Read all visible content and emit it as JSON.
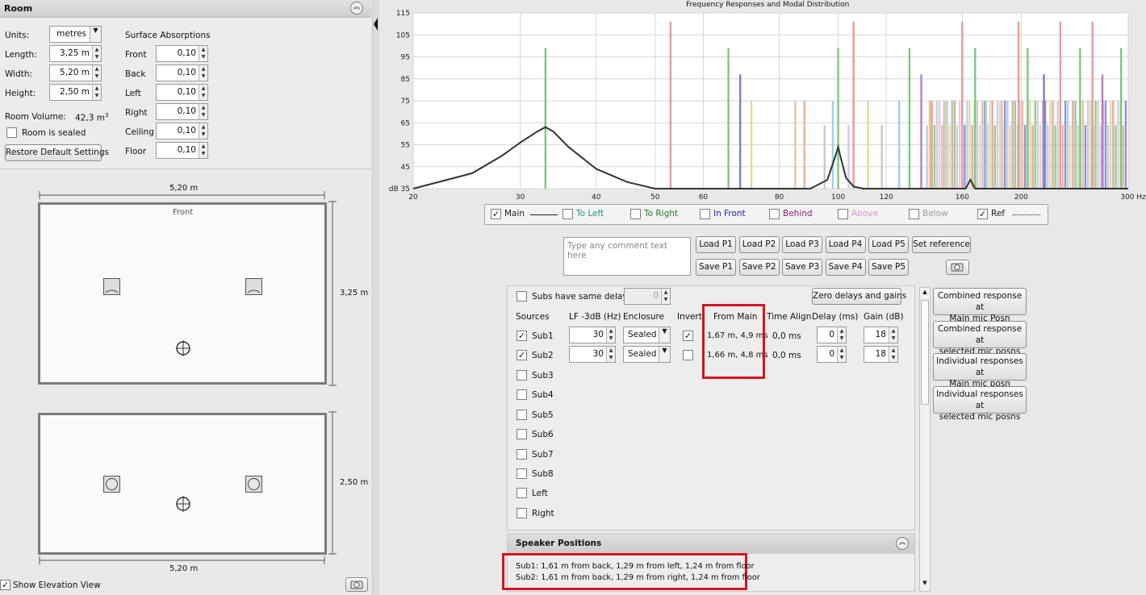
{
  "room": {
    "title": "Room",
    "units_label": "Units:",
    "units_value": "metres",
    "length_label": "Length:",
    "length_value": "3,25 m",
    "width_label": "Width:",
    "width_value": "5,20 m",
    "height_label": "Height:",
    "height_value": "2,50 m",
    "volume_label": "Room Volume:",
    "volume_value": "42,3 m",
    "volume_sup": "3",
    "sealed_label": "Room is sealed",
    "restore_label": "Restore Default Settings",
    "absorptions_title": "Surface Absorptions",
    "surfaces": [
      {
        "label": "Front",
        "value": "0,10"
      },
      {
        "label": "Back",
        "value": "0,10"
      },
      {
        "label": "Left",
        "value": "0,10"
      },
      {
        "label": "Right",
        "value": "0,10"
      },
      {
        "label": "Ceiling",
        "value": "0,10"
      },
      {
        "label": "Floor",
        "value": "0,10"
      }
    ]
  },
  "plan": {
    "top_width": "5,20 m",
    "front_label": "Front",
    "depth": "3,25 m",
    "height": "2,50 m",
    "bottom_width": "5,20 m",
    "show_elevation": "Show Elevation View"
  },
  "chart_data": {
    "type": "line",
    "title": "Frequency Responses and Modal Distribution",
    "xlabel": "Hz",
    "ylabel": "dB",
    "x_scale": "log",
    "xlim": [
      20,
      300
    ],
    "ylim": [
      35,
      115
    ],
    "x_ticks": [
      "20",
      "30",
      "40",
      "50",
      "60",
      "80",
      "100",
      "120",
      "160",
      "200",
      "300 Hz"
    ],
    "y_ticks": [
      "115",
      "105",
      "95",
      "85",
      "75",
      "65",
      "55",
      "45",
      "dB 35"
    ],
    "grid": true,
    "series": [
      {
        "name": "Main",
        "x": [
          20,
          25,
          28,
          30,
          32,
          33,
          34,
          36,
          40,
          45,
          50,
          90,
          96,
          99,
          100,
          101,
          103,
          106,
          110,
          150,
          162,
          165,
          168,
          300
        ],
        "y": [
          35,
          42,
          50,
          56,
          61,
          63,
          61,
          54,
          44,
          38,
          35,
          35,
          39,
          50,
          54,
          49,
          40,
          36,
          35,
          35,
          35,
          39,
          35,
          35
        ]
      }
    ],
    "modal_lines": [
      {
        "f": 33,
        "db": 99,
        "color": "#7fc77f"
      },
      {
        "f": 53,
        "db": 111,
        "color": "#e89a9a"
      },
      {
        "f": 66,
        "db": 99,
        "color": "#7fc77f"
      },
      {
        "f": 69,
        "db": 87,
        "color": "#7f7fc7"
      },
      {
        "f": 72,
        "db": 75,
        "color": "#e5d79a"
      },
      {
        "f": 85,
        "db": 75,
        "color": "#e5c79a"
      },
      {
        "f": 88,
        "db": 75,
        "color": "#e8b38f"
      },
      {
        "f": 95,
        "db": 64,
        "color": "#c9c9c9"
      },
      {
        "f": 98,
        "db": 75,
        "color": "#9fd0e8"
      },
      {
        "f": 100,
        "db": 99,
        "color": "#7fc77f"
      },
      {
        "f": 104,
        "db": 64,
        "color": "#d8c7e8"
      },
      {
        "f": 106,
        "db": 111,
        "color": "#e89a9a"
      },
      {
        "f": 112,
        "db": 75,
        "color": "#e5d79a"
      },
      {
        "f": 118,
        "db": 64,
        "color": "#c9c9c9"
      },
      {
        "f": 126,
        "db": 75,
        "color": "#9fd0e8"
      },
      {
        "f": 131,
        "db": 99,
        "color": "#7fc77f"
      },
      {
        "f": 137,
        "db": 87,
        "color": "#b27fc7"
      },
      {
        "f": 142,
        "db": 75,
        "color": "#e8b38f"
      },
      {
        "f": 150,
        "db": 75,
        "color": "#e5d79a"
      },
      {
        "f": 160,
        "db": 111,
        "color": "#e89a9a"
      },
      {
        "f": 168,
        "db": 99,
        "color": "#7fc77f"
      },
      {
        "f": 175,
        "db": 75,
        "color": "#9fd0e8"
      },
      {
        "f": 186,
        "db": 75,
        "color": "#e5c79a"
      },
      {
        "f": 198,
        "db": 111,
        "color": "#e89a9a"
      },
      {
        "f": 205,
        "db": 99,
        "color": "#7fc77f"
      },
      {
        "f": 218,
        "db": 87,
        "color": "#7f7fc7"
      },
      {
        "f": 232,
        "db": 111,
        "color": "#e89a9a"
      },
      {
        "f": 250,
        "db": 99,
        "color": "#7fc77f"
      },
      {
        "f": 262,
        "db": 111,
        "color": "#e89a9a"
      },
      {
        "f": 272,
        "db": 87,
        "color": "#b27fc7"
      },
      {
        "f": 292,
        "db": 99,
        "color": "#7fc77f"
      }
    ],
    "dense_region": {
      "from": 140,
      "to": 300,
      "db": 75
    }
  },
  "legend": [
    {
      "label": "Main",
      "checked": true,
      "color": "#222222",
      "line": "solid"
    },
    {
      "label": "To Left",
      "checked": false,
      "color": "#2a8f8f"
    },
    {
      "label": "To Right",
      "checked": false,
      "color": "#2a7a2a"
    },
    {
      "label": "In Front",
      "checked": false,
      "color": "#23239a"
    },
    {
      "label": "Behind",
      "checked": false,
      "color": "#7a1f7a"
    },
    {
      "label": "Above",
      "checked": false,
      "color": "#d49ad4"
    },
    {
      "label": "Below",
      "checked": false,
      "color": "#9a9a9a"
    },
    {
      "label": "Ref",
      "checked": true,
      "color": "#222222",
      "line": "dotted"
    }
  ],
  "comment_placeholder": "Type any comment text here",
  "load_buttons": [
    "Load P1",
    "Load P2",
    "Load P3",
    "Load P4",
    "Load P5"
  ],
  "save_buttons": [
    "Save P1",
    "Save P2",
    "Save P3",
    "Save P4",
    "Save P5"
  ],
  "set_reference": "Set reference",
  "subs": {
    "same_delay_label": "Subs have same delay",
    "same_delay_value": "0",
    "zero_button": "Zero delays and gains",
    "headers": {
      "sources": "Sources",
      "lf": "LF -3dB (Hz)",
      "enclosure": "Enclosure",
      "invert": "Invert",
      "from_main": "From Main",
      "time_align": "Time Align",
      "delay": "Delay (ms)",
      "gain": "Gain (dB)"
    },
    "active": [
      {
        "name": "Sub1",
        "checked": true,
        "lf": "30",
        "enclosure": "Sealed",
        "invert": true,
        "from_main": "1,67 m, 4,9 ms",
        "time_align": "0,0 ms",
        "delay": "0",
        "gain": "18"
      },
      {
        "name": "Sub2",
        "checked": true,
        "lf": "30",
        "enclosure": "Sealed",
        "invert": false,
        "from_main": "1,66 m, 4,8 ms",
        "time_align": "0,0 ms",
        "delay": "0",
        "gain": "18"
      }
    ],
    "inactive": [
      "Sub3",
      "Sub4",
      "Sub5",
      "Sub6",
      "Sub7",
      "Sub8",
      "Left",
      "Right"
    ]
  },
  "speaker_positions": {
    "title": "Speaker Positions",
    "lines": [
      "Sub1: 1,61 m from back, 1,29 m from left, 1,24 m from floor",
      "Sub2: 1,61 m from back, 1,29 m from right, 1,24 m from floor"
    ]
  },
  "side_buttons": [
    [
      "Combined response at",
      "Main mic Posn"
    ],
    [
      "Combined response at",
      "selected mic posns"
    ],
    [
      "Individual responses at",
      "Main mic posn"
    ],
    [
      "Individual responses at",
      "selected mic posns"
    ]
  ]
}
